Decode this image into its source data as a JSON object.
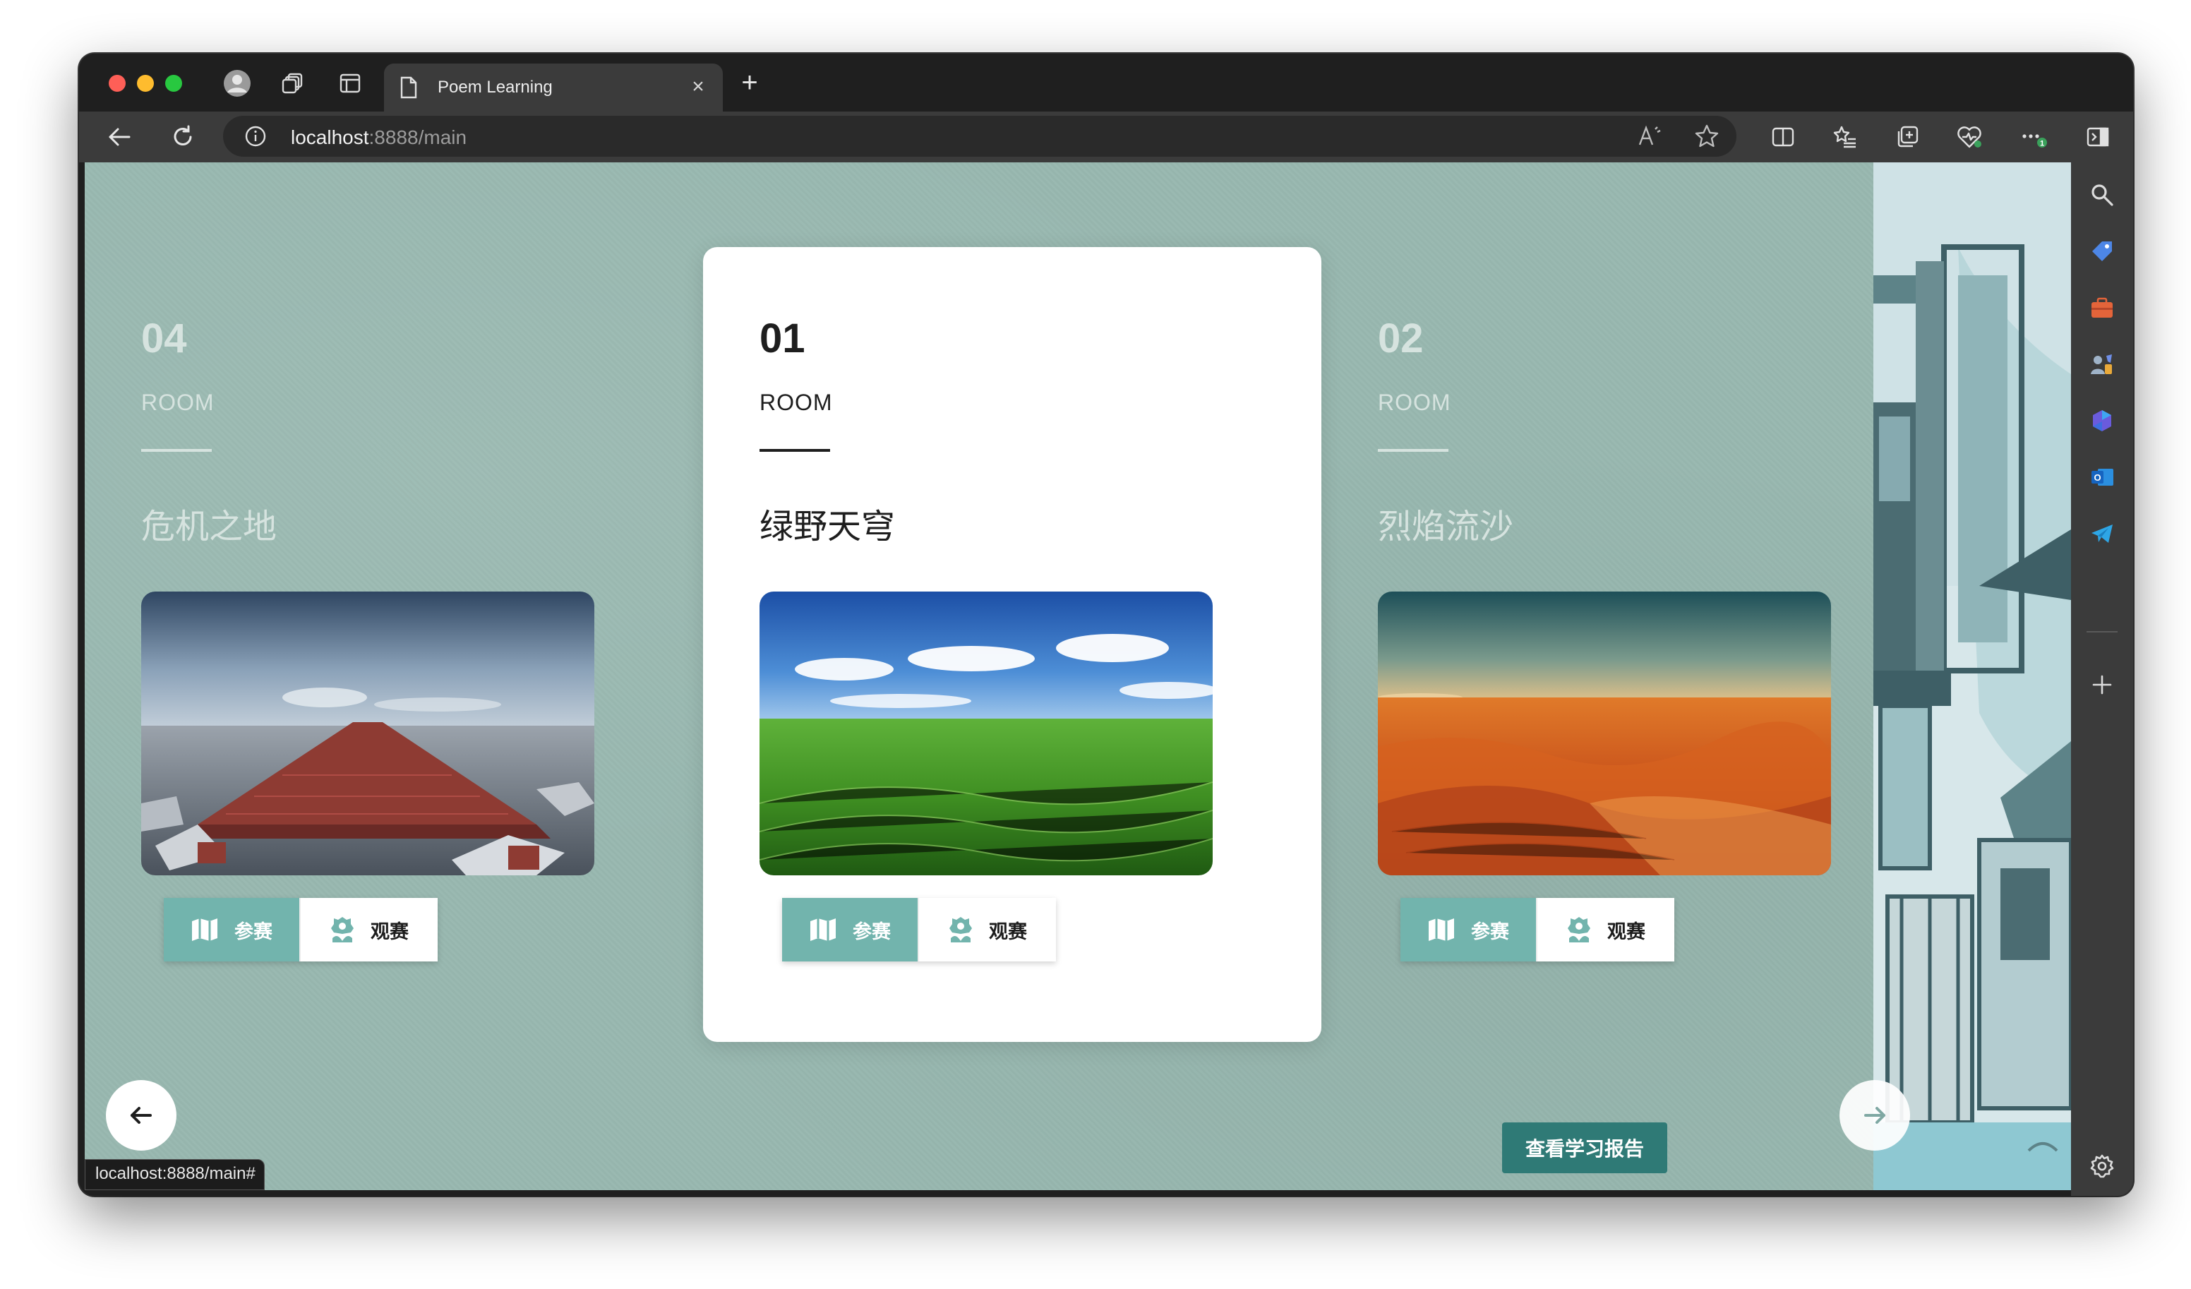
{
  "browser": {
    "tab_title": "Poem Learning",
    "url_host": "localhost",
    "url_rest": ":8888/main",
    "status_url": "localhost:8888/main#"
  },
  "rooms": [
    {
      "number": "04",
      "label": "ROOM",
      "name": "危机之地",
      "join_label": "参赛",
      "watch_label": "观赛",
      "scene": "crisis-land-image",
      "active": false
    },
    {
      "number": "01",
      "label": "ROOM",
      "name": "绿野天穹",
      "join_label": "参赛",
      "watch_label": "观赛",
      "scene": "green-field-sky-image",
      "active": true
    },
    {
      "number": "02",
      "label": "ROOM",
      "name": "烈焰流沙",
      "join_label": "参赛",
      "watch_label": "观赛",
      "scene": "desert-dunes-image",
      "active": false
    }
  ],
  "report_button": "查看学习报告",
  "colors": {
    "page_bg": "#98b8b0",
    "join_button": "#72b4ad",
    "report_button": "#2f7a76"
  },
  "icons": {
    "prev": "arrow-left-icon",
    "next": "arrow-right-icon",
    "join": "map-icon",
    "watch": "flower-icon"
  }
}
